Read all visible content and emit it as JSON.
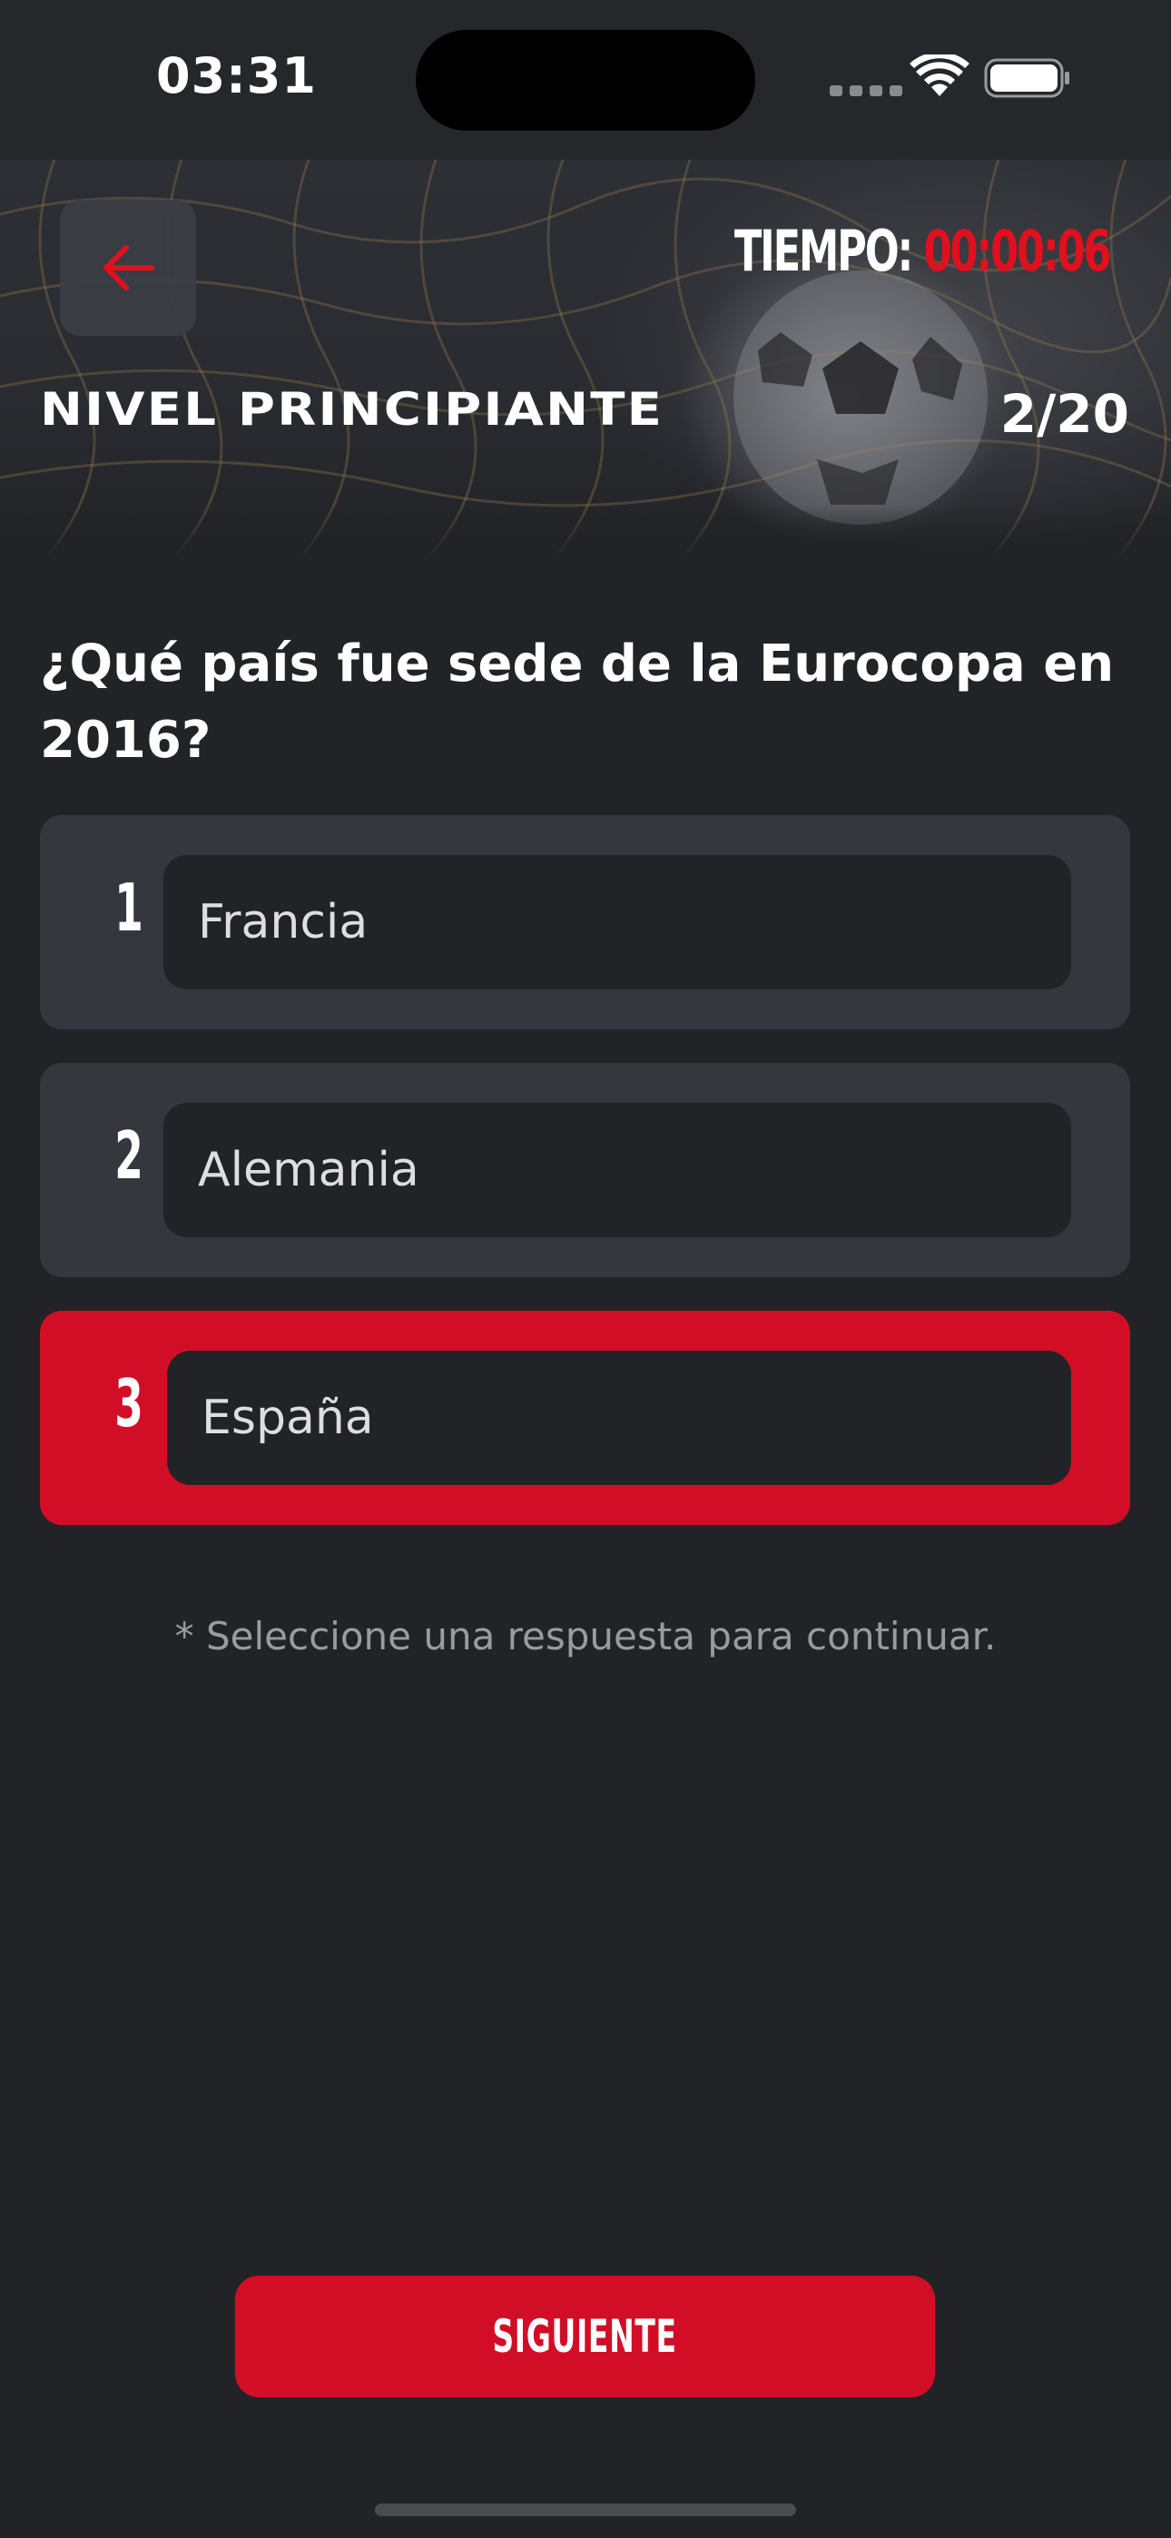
{
  "status_bar": {
    "time": "03:31"
  },
  "header": {
    "back_icon": "arrow-left-icon",
    "timer_label": "TIEMPO:",
    "timer_value": "00:00:06",
    "level_title": "NIVEL PRINCIPIANTE",
    "progress": "2/20"
  },
  "question": {
    "text": "¿Qué país fue sede de la Eurocopa en 2016?"
  },
  "options": [
    {
      "number": "1",
      "label": "Francia",
      "selected": false
    },
    {
      "number": "2",
      "label": "Alemania",
      "selected": false
    },
    {
      "number": "3",
      "label": "España",
      "selected": true
    }
  ],
  "hint": "* Seleccione una respuesta para continuar.",
  "next_button": {
    "label": "SIGUIENTE"
  },
  "colors": {
    "accent": "#d20e27",
    "timer": "#e0101e",
    "background": "#222327",
    "option_bg": "#34373e"
  }
}
